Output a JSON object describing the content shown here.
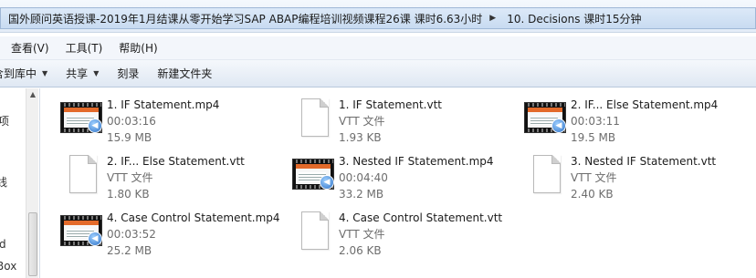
{
  "breadcrumb": {
    "items": [
      "国外顾问英语授课-2019年1月结课从零开始学习SAP ABAP编程培训视频课程26课 课时6.63小时",
      "10. Decisions 课时15分钟"
    ]
  },
  "menubar": {
    "items": [
      "查看(V)",
      "工具(T)",
      "帮助(H)"
    ]
  },
  "toolbar": {
    "include_library": "含到库中",
    "share": "共享",
    "burn": "刻录",
    "new_folder": "新建文件夹"
  },
  "navpane": {
    "fragments": [
      "项",
      "线",
      "d",
      "Box"
    ]
  },
  "files": [
    {
      "name": "1. IF Statement.mp4",
      "meta1": "00:03:16",
      "meta2": "15.9 MB",
      "icon": "video-file-icon"
    },
    {
      "name": "1. IF Statement.vtt",
      "meta1": "VTT 文件",
      "meta2": "1.93 KB",
      "icon": "document-file-icon"
    },
    {
      "name": "2. IF... Else Statement.mp4",
      "meta1": "00:03:11",
      "meta2": "19.5 MB",
      "icon": "video-file-icon"
    },
    {
      "name": "2. IF... Else Statement.vtt",
      "meta1": "VTT 文件",
      "meta2": "1.80 KB",
      "icon": "document-file-icon"
    },
    {
      "name": "3. Nested IF Statement.mp4",
      "meta1": "00:04:40",
      "meta2": "33.2 MB",
      "icon": "video-file-icon"
    },
    {
      "name": "3. Nested IF Statement.vtt",
      "meta1": "VTT 文件",
      "meta2": "2.40 KB",
      "icon": "document-file-icon"
    },
    {
      "name": "4. Case Control Statement.mp4",
      "meta1": "00:03:52",
      "meta2": "25.2 MB",
      "icon": "video-file-icon"
    },
    {
      "name": "4. Case Control Statement.vtt",
      "meta1": "VTT 文件",
      "meta2": "2.06 KB",
      "icon": "document-file-icon"
    }
  ]
}
